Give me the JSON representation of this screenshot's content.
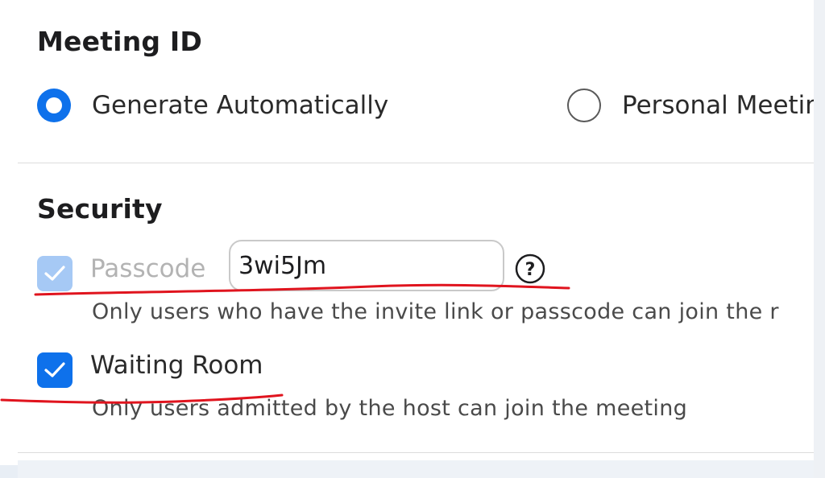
{
  "meeting_id": {
    "title": "Meeting ID",
    "options": [
      {
        "label": "Generate Automatically",
        "selected": true
      },
      {
        "label": "Personal Meetin",
        "selected": false
      }
    ]
  },
  "security": {
    "title": "Security",
    "passcode": {
      "label": "Passcode",
      "checked": true,
      "disabled": true,
      "value": "3wi5Jm",
      "description": "Only users who have the invite link or passcode can join the r",
      "help_icon": "question-circle-icon"
    },
    "waiting_room": {
      "label": "Waiting Room",
      "checked": true,
      "description": "Only users admitted by the host can join the meeting"
    }
  },
  "colors": {
    "accent": "#0e71eb",
    "disabled_accent": "#a6c9f5",
    "annotation": "#e0141e"
  }
}
